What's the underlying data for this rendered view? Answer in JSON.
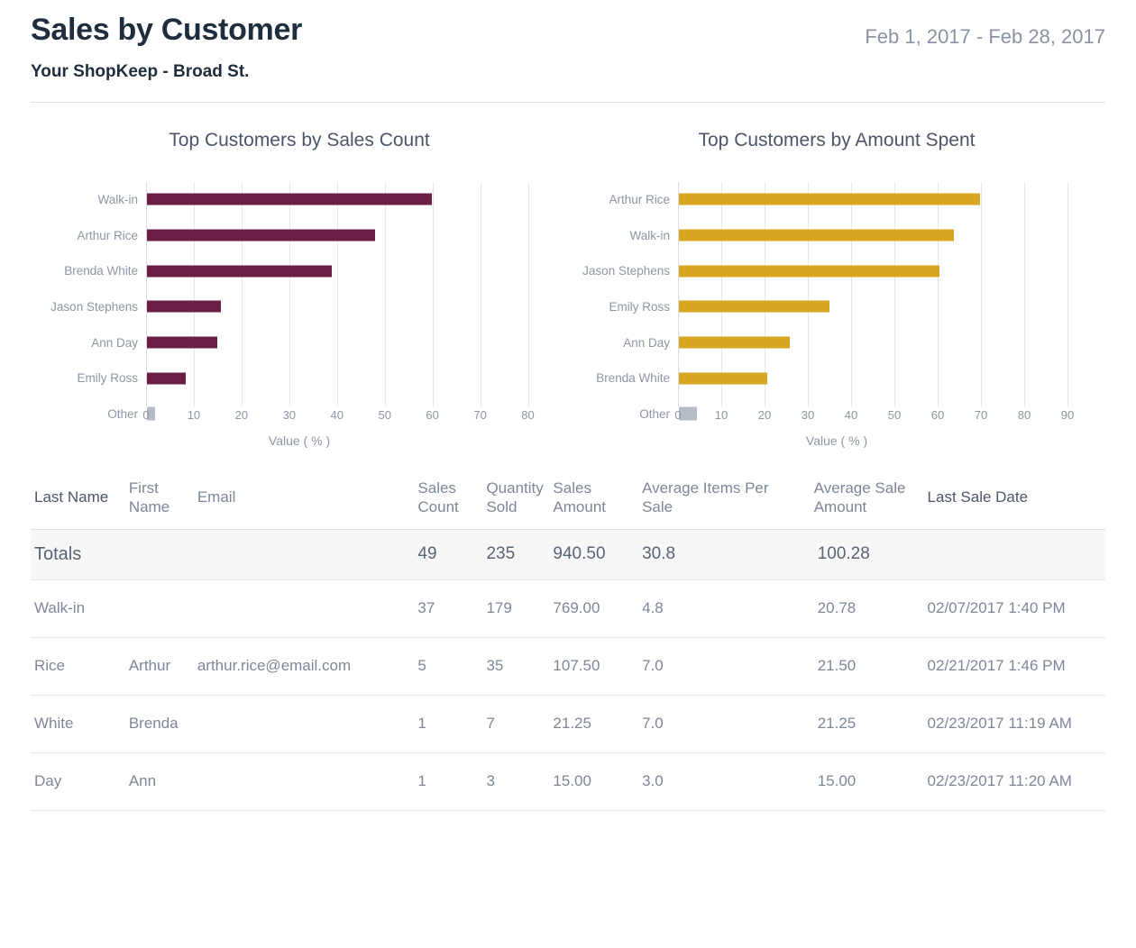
{
  "header": {
    "title": "Sales by Customer",
    "date_range": "Feb 1, 2017 - Feb 28, 2017",
    "store": "Your ShopKeep - Broad St."
  },
  "colors": {
    "maroon": "#6B1F44",
    "gold": "#D9A520",
    "other_gray": "#B6BCC6",
    "title_navy": "#1f2d3d",
    "muted": "#8d96a4"
  },
  "chart_data": [
    {
      "type": "bar",
      "orientation": "horizontal",
      "title": "Top Customers by Sales Count",
      "xlabel": "Value ( % )",
      "ylabel": "",
      "xlim": [
        0,
        85
      ],
      "xticks": [
        0,
        10,
        20,
        30,
        40,
        50,
        60,
        70,
        80
      ],
      "grid": true,
      "legend": "none",
      "bar_color": "#6B1F44",
      "other_color": "#B6BCC6",
      "categories": [
        "Walk-in",
        "Arthur Rice",
        "Brenda White",
        "Jason Stephens",
        "Ann Day",
        "Emily Ross",
        "Other"
      ],
      "values": [
        59.7,
        47.7,
        38.8,
        15.5,
        14.7,
        8.2,
        1.7
      ]
    },
    {
      "type": "bar",
      "orientation": "horizontal",
      "title": "Top Customers by Amount Spent",
      "xlabel": "Value ( % )",
      "ylabel": "",
      "xlim": [
        0,
        95
      ],
      "xticks": [
        0,
        10,
        20,
        30,
        40,
        50,
        60,
        70,
        80,
        90
      ],
      "grid": true,
      "legend": "none",
      "bar_color": "#D9A520",
      "other_color": "#B6BCC6",
      "categories": [
        "Arthur Rice",
        "Walk-in",
        "Jason Stephens",
        "Emily Ross",
        "Ann Day",
        "Brenda White",
        "Other"
      ],
      "values": [
        69.5,
        63.5,
        60.3,
        34.7,
        25.6,
        20.5,
        4.2
      ]
    }
  ],
  "table": {
    "headers": {
      "last_name": "Last Name",
      "first_name": "First Name",
      "email": "Email",
      "sales_count": "Sales Count",
      "quantity_sold": "Quantity Sold",
      "sales_amount": "Sales Amount",
      "avg_items_per_sale": "Average Items Per Sale",
      "avg_sale_amount": "Average Sale Amount",
      "last_sale_date": "Last Sale Date"
    },
    "totals": {
      "label": "Totals",
      "sales_count": "49",
      "quantity_sold": "235",
      "sales_amount": "940.50",
      "avg_items_per_sale": "30.8",
      "avg_sale_amount": "100.28",
      "last_sale_date": ""
    },
    "rows": [
      {
        "last_name": "Walk-in",
        "first_name": "",
        "email": "",
        "sales_count": "37",
        "quantity_sold": "179",
        "sales_amount": "769.00",
        "avg_items_per_sale": "4.8",
        "avg_sale_amount": "20.78",
        "last_sale_date": "02/07/2017 1:40 PM"
      },
      {
        "last_name": "Rice",
        "first_name": "Arthur",
        "email": "arthur.rice@email.com",
        "sales_count": "5",
        "quantity_sold": "35",
        "sales_amount": "107.50",
        "avg_items_per_sale": "7.0",
        "avg_sale_amount": "21.50",
        "last_sale_date": "02/21/2017 1:46 PM"
      },
      {
        "last_name": "White",
        "first_name": "Brenda",
        "email": "",
        "sales_count": "1",
        "quantity_sold": "7",
        "sales_amount": "21.25",
        "avg_items_per_sale": "7.0",
        "avg_sale_amount": "21.25",
        "last_sale_date": "02/23/2017 11:19 AM"
      },
      {
        "last_name": "Day",
        "first_name": "Ann",
        "email": "",
        "sales_count": "1",
        "quantity_sold": "3",
        "sales_amount": "15.00",
        "avg_items_per_sale": "3.0",
        "avg_sale_amount": "15.00",
        "last_sale_date": "02/23/2017 11:20 AM"
      }
    ]
  }
}
